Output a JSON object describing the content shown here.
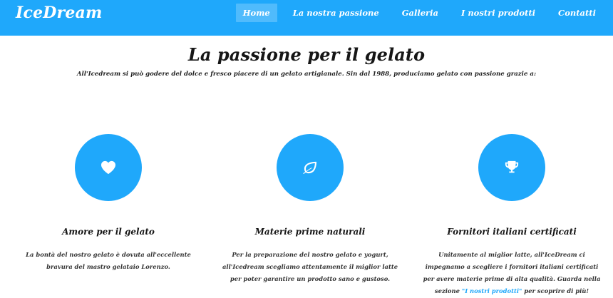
{
  "brand": {
    "name": "IceDream"
  },
  "nav": {
    "items": [
      {
        "label": "Home",
        "active": true
      },
      {
        "label": "La nostra passione",
        "active": false
      },
      {
        "label": "Galleria",
        "active": false
      },
      {
        "label": "I nostri prodotti",
        "active": false
      },
      {
        "label": "Contatti",
        "active": false
      }
    ]
  },
  "hero": {
    "title": "La passione per il gelato",
    "subtitle": "All'Icedream si può godere del dolce e fresco piacere di un gelato artigianale. Sin dal 1988, produciamo gelato con passione grazie a:"
  },
  "features": [
    {
      "icon": "heart-icon",
      "title": "Amore per il gelato",
      "text": "La bontà del nostro gelato è dovuta all'eccellente bravura del mastro gelataio Lorenzo."
    },
    {
      "icon": "leaf-icon",
      "title": "Materie prime naturali",
      "text": "Per la preparazione del nostro gelato e yogurt, all'Icedream scegliamo attentamente il miglior latte per poter garantire un prodotto sano e gustoso."
    },
    {
      "icon": "trophy-icon",
      "title": "Fornitori italiani certificati",
      "text_before": "Unitamente al miglior latte, all'IceDream ci impegnamo a scegliere i fornitori italiani certificati per avere materie prime di alta qualità. Guarda nella sezione ",
      "link_text": "\"I nostri prodotti\"",
      "text_after": " per scoprire di più!"
    }
  ],
  "colors": {
    "accent": "#1fa8fb",
    "text": "#161616",
    "background": "#ffffff"
  }
}
